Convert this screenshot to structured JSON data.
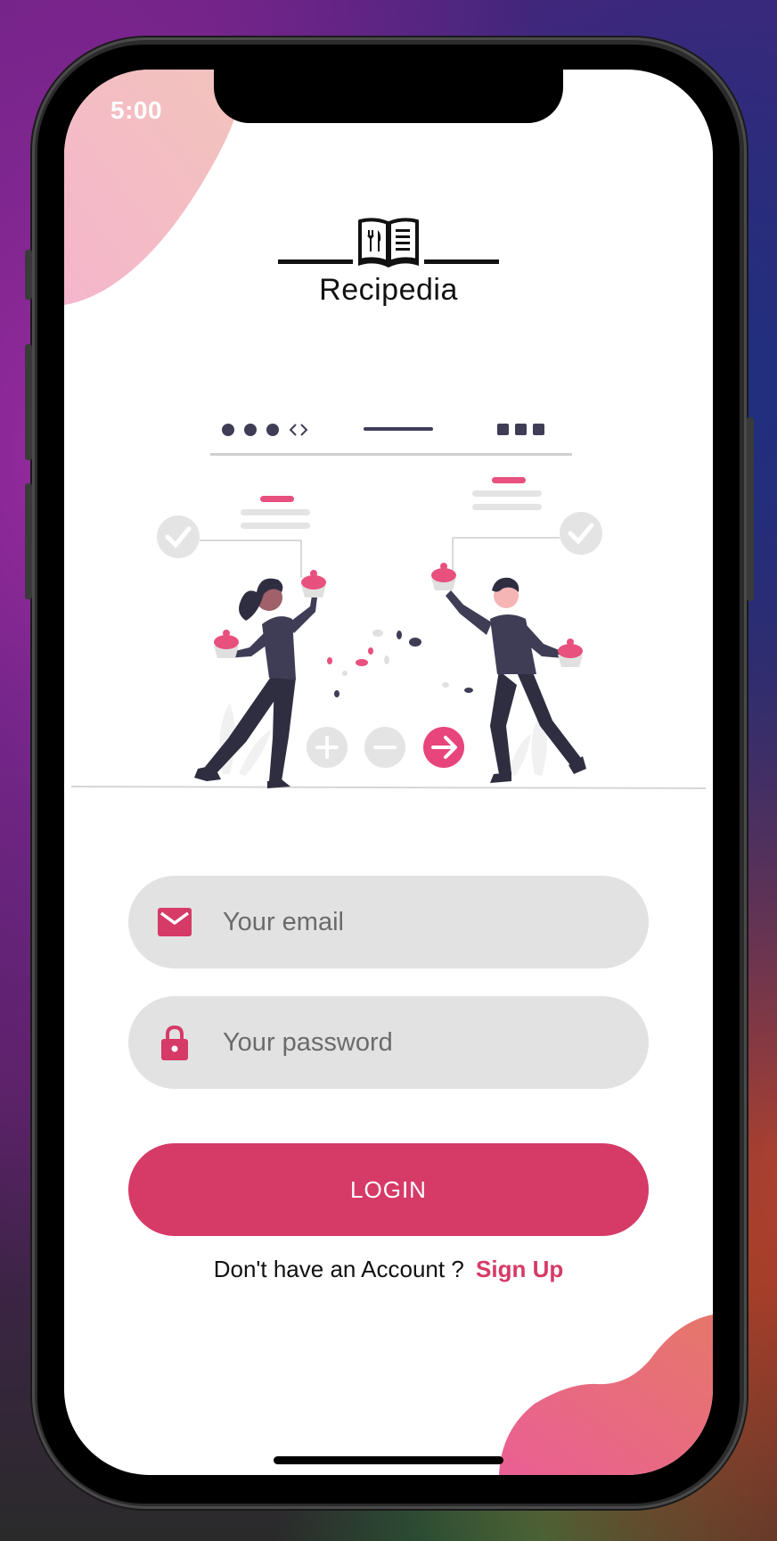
{
  "status_bar": {
    "time": "5:00"
  },
  "logo": {
    "app_name": "Recipedia"
  },
  "form": {
    "email_placeholder": "Your email",
    "password_placeholder": "Your password"
  },
  "actions": {
    "login_label": "LOGIN",
    "signup_prompt": "Don't have an Account ?",
    "signup_link": "Sign Up"
  },
  "icons": {
    "email": "mail-icon",
    "password": "lock-icon",
    "logo": "recipe-book-icon"
  },
  "colors": {
    "accent": "#d63a67",
    "field_bg": "#e2e2e2",
    "blob_top": "#f3b2c8",
    "blob_bottom": "#e9607a"
  }
}
